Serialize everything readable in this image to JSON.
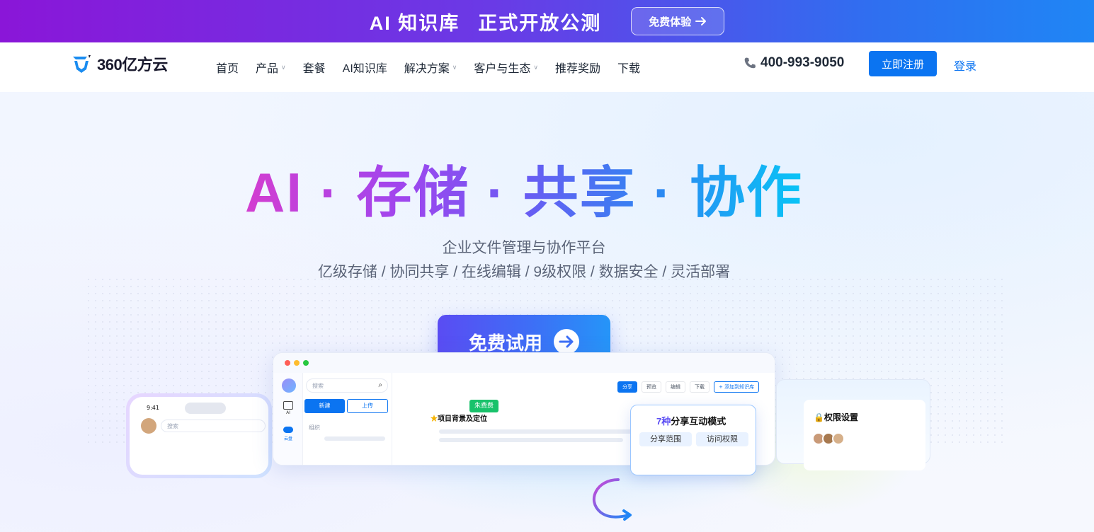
{
  "banner": {
    "left_text": "AI 知识库",
    "right_text": "正式开放公测",
    "button_label": "免费体验"
  },
  "nav": {
    "logo_text": "360亿方云",
    "items": [
      {
        "label": "首页",
        "has_dropdown": false
      },
      {
        "label": "产品",
        "has_dropdown": true
      },
      {
        "label": "套餐",
        "has_dropdown": false
      },
      {
        "label": "AI知识库",
        "has_dropdown": false
      },
      {
        "label": "解决方案",
        "has_dropdown": true
      },
      {
        "label": "客户与生态",
        "has_dropdown": true
      },
      {
        "label": "推荐奖励",
        "has_dropdown": false
      },
      {
        "label": "下载",
        "has_dropdown": false
      }
    ],
    "phone": "400-993-9050",
    "register_label": "立即注册",
    "login_label": "登录"
  },
  "hero": {
    "headline": "AI · 存储 · 共享 · 协作",
    "subtitle": "企业文件管理与协作平台",
    "features": "亿级存储 / 协同共享 / 在线编辑 / 9级权限 / 数据安全 / 灵活部署",
    "cta_label": "免费试用"
  },
  "mockup": {
    "search_placeholder": "搜索",
    "sidebar_ai": "AI",
    "sidebar_cloud": "云盘",
    "new_button": "新建",
    "upload_button": "上传",
    "group_label": "组织",
    "tabs": [
      "分享",
      "预览",
      "编辑",
      "下载",
      "+ 添加到知识库"
    ],
    "badge": "朱费费",
    "project_title": "项目背景及定位",
    "share_panel": {
      "count": "7种",
      "title": "分享互动模式",
      "btn1": "分享范围",
      "btn2": "访问权限"
    },
    "permission_title": "权限设置",
    "phone_time": "9:41",
    "phone_search": "搜索"
  },
  "colors": {
    "brand_blue": "#0b74f1",
    "banner_start": "#8a16d8",
    "banner_end": "#1f86f5",
    "badge_green": "#19c26b"
  }
}
